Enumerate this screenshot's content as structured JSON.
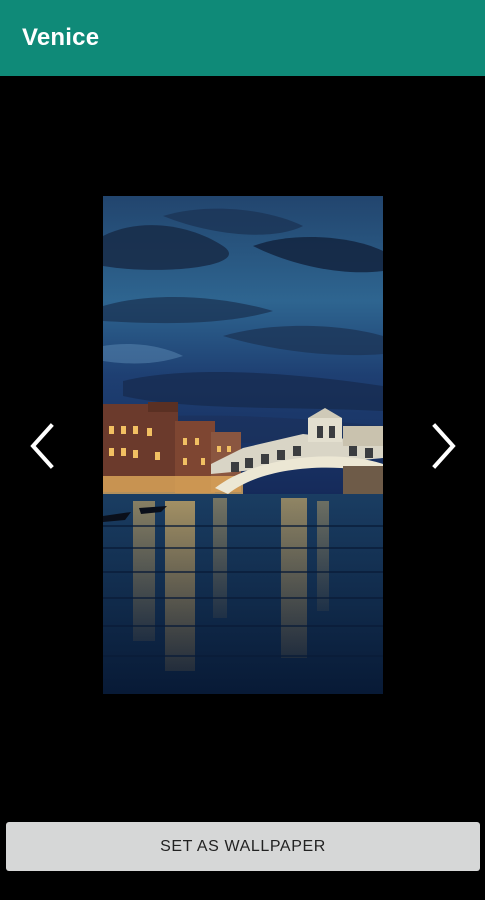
{
  "app_bar": {
    "title": "Venice",
    "color": "#0f8a78"
  },
  "gallery": {
    "previous_icon": "chevron-left-icon",
    "next_icon": "chevron-right-icon",
    "image_subject": "Rialto Bridge over the Grand Canal at dusk"
  },
  "actions": {
    "set_wallpaper_label": "SET AS WALLPAPER"
  }
}
